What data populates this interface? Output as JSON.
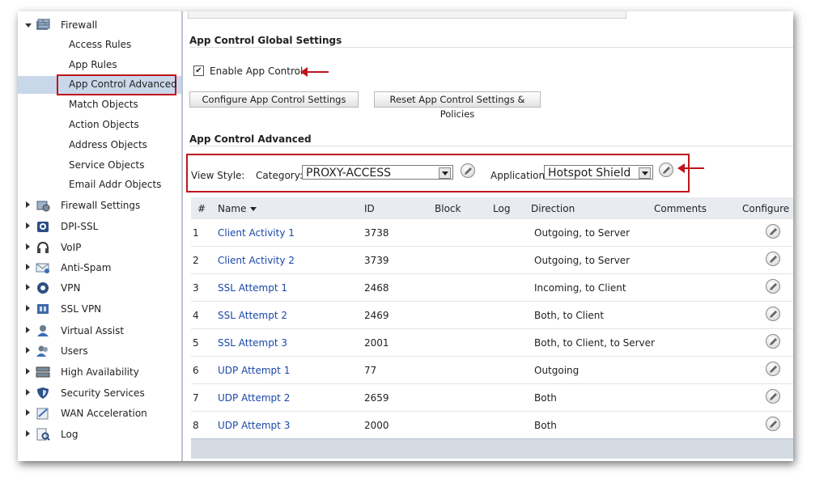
{
  "sidebar": {
    "firewall": "Firewall",
    "firewall_children": [
      "Access Rules",
      "App Rules",
      "App Control Advanced",
      "Match Objects",
      "Action Objects",
      "Address Objects",
      "Service Objects",
      "Email Addr Objects"
    ],
    "selected": "App Control Advanced",
    "sections": [
      {
        "label": "Firewall Settings",
        "icon": "firewall-settings-icon"
      },
      {
        "label": "DPI-SSL",
        "icon": "dpi-ssl-icon"
      },
      {
        "label": "VoIP",
        "icon": "voip-headset-icon"
      },
      {
        "label": "Anti-Spam",
        "icon": "anti-spam-envelope-icon"
      },
      {
        "label": "VPN",
        "icon": "vpn-lock-icon"
      },
      {
        "label": "SSL VPN",
        "icon": "ssl-vpn-icon"
      },
      {
        "label": "Virtual Assist",
        "icon": "virtual-assist-icon"
      },
      {
        "label": "Users",
        "icon": "users-icon"
      },
      {
        "label": "High Availability",
        "icon": "high-availability-icon"
      },
      {
        "label": "Security Services",
        "icon": "shield-icon"
      },
      {
        "label": "WAN Acceleration",
        "icon": "wan-acceleration-icon"
      },
      {
        "label": "Log",
        "icon": "log-icon"
      }
    ]
  },
  "global": {
    "title": "App Control Global Settings",
    "enable_label": "Enable App Control",
    "enable_checked": "✔",
    "configure_btn": "Configure App Control Settings",
    "reset_btn": "Reset App Control Settings & Policies"
  },
  "advanced": {
    "title": "App Control Advanced",
    "view_style_label": "View Style:",
    "category_label": "Category:",
    "category_value": "PROXY-ACCESS",
    "application_label": "Application:",
    "application_value": "Hotspot Shield"
  },
  "table": {
    "headers": {
      "num": "#",
      "name": "Name",
      "id": "ID",
      "block": "Block",
      "log": "Log",
      "direction": "Direction",
      "comments": "Comments",
      "configure": "Configure"
    },
    "rows": [
      {
        "num": "1",
        "name": "Client Activity 1",
        "id": "3738",
        "direction": "Outgoing, to Server"
      },
      {
        "num": "2",
        "name": "Client Activity 2",
        "id": "3739",
        "direction": "Outgoing, to Server"
      },
      {
        "num": "3",
        "name": "SSL Attempt 1",
        "id": "2468",
        "direction": "Incoming, to Client"
      },
      {
        "num": "4",
        "name": "SSL Attempt 2",
        "id": "2469",
        "direction": "Both, to Client"
      },
      {
        "num": "5",
        "name": "SSL Attempt 3",
        "id": "2001",
        "direction": "Both, to Client, to Server"
      },
      {
        "num": "6",
        "name": "UDP Attempt 1",
        "id": "77",
        "direction": "Outgoing"
      },
      {
        "num": "7",
        "name": "UDP Attempt 2",
        "id": "2659",
        "direction": "Both"
      },
      {
        "num": "8",
        "name": "UDP Attempt 3",
        "id": "2000",
        "direction": "Both"
      }
    ]
  },
  "colors": {
    "highlight_red": "#c0141c",
    "link_blue": "#1a48a8",
    "selected_bg": "#c9d7ea"
  }
}
